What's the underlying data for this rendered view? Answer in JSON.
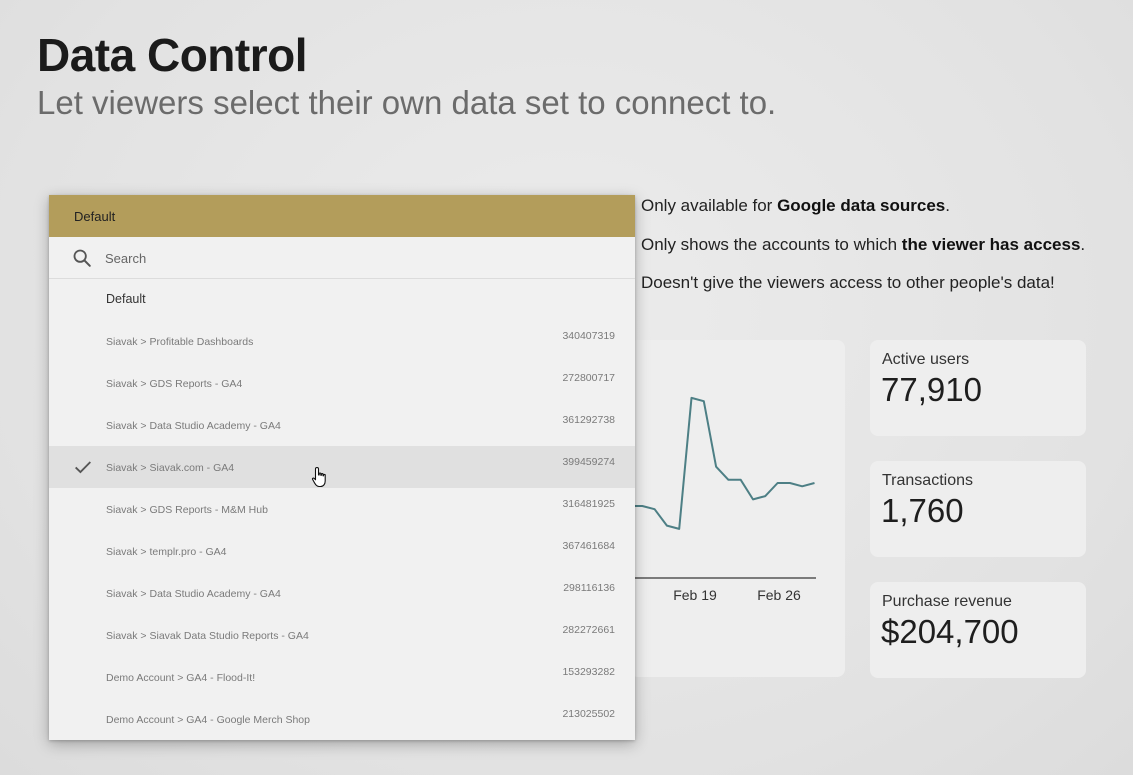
{
  "slide": {
    "title": "Data Control",
    "subtitle": "Let viewers select their own data set to connect to."
  },
  "info": {
    "line1_prefix": "Only available for ",
    "line1_bold": "Google data sources",
    "line1_suffix": ".",
    "line2_prefix": "Only shows the accounts to which ",
    "line2_bold": "the viewer has access",
    "line2_suffix": ".",
    "line3": "Doesn't give the viewers access to other people's data!"
  },
  "dropdown": {
    "header_label": "Default",
    "search_placeholder": "Search",
    "default_option": "Default",
    "items": [
      {
        "name": "Siavak > Profitable Dashboards",
        "id": "340407319",
        "selected": false
      },
      {
        "name": "Siavak > GDS Reports - GA4",
        "id": "272800717",
        "selected": false
      },
      {
        "name": "Siavak > Data Studio Academy - GA4",
        "id": "361292738",
        "selected": false
      },
      {
        "name": "Siavak > Siavak.com - GA4",
        "id": "399459274",
        "selected": true
      },
      {
        "name": "Siavak > GDS Reports - M&M Hub",
        "id": "316481925",
        "selected": false
      },
      {
        "name": "Siavak > templr.pro - GA4",
        "id": "367461684",
        "selected": false
      },
      {
        "name": "Siavak > Data Studio Academy - GA4",
        "id": "298116136",
        "selected": false
      },
      {
        "name": "Siavak > Siavak Data Studio Reports - GA4",
        "id": "282272661",
        "selected": false
      },
      {
        "name": "Demo Account > GA4 - Flood-It!",
        "id": "153293282",
        "selected": false
      },
      {
        "name": "Demo Account > GA4 - Google Merch Shop",
        "id": "213025502",
        "selected": false
      }
    ]
  },
  "kpis": [
    {
      "label": "Active users",
      "value": "77,910"
    },
    {
      "label": "Transactions",
      "value": "1,760"
    },
    {
      "label": "Purchase revenue",
      "value": "$204,700"
    }
  ],
  "chart_data": {
    "type": "line",
    "x_tick_labels": [
      "Feb 19",
      "Feb 26"
    ],
    "series": [
      {
        "values": [
          22,
          22,
          21,
          16,
          15,
          55,
          54,
          34,
          30,
          30,
          24,
          25,
          29,
          29,
          28,
          29
        ]
      }
    ],
    "ylim": [
      0,
      62
    ],
    "grid": false,
    "line_color": "#4d7f85"
  },
  "colors": {
    "header": "#b39d5b",
    "line": "#4d7f85"
  }
}
